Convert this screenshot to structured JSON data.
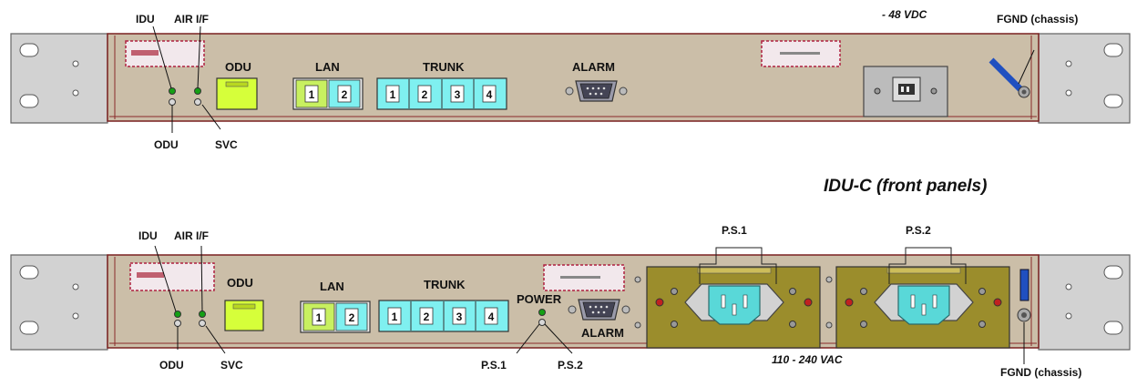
{
  "title": "IDU-C (front panels)",
  "dc_panel": {
    "idu_label": "IDU",
    "air_label": "AIR I/F",
    "odu_port_label": "ODU",
    "lan_label": "LAN",
    "lan_ports": [
      "1",
      "2"
    ],
    "trunk_label": "TRUNK",
    "trunk_ports": [
      "1",
      "2",
      "3",
      "4"
    ],
    "alarm_label": "ALARM",
    "odu_led_label": "ODU",
    "svc_led_label": "SVC",
    "dc_label": "- 48 VDC",
    "fgnd_label": "FGND (chassis)"
  },
  "ac_panel": {
    "idu_label": "IDU",
    "air_label": "AIR I/F",
    "odu_port_label": "ODU",
    "lan_label": "LAN",
    "lan_ports": [
      "1",
      "2"
    ],
    "trunk_label": "TRUNK",
    "trunk_ports": [
      "1",
      "2",
      "3",
      "4"
    ],
    "power_label": "POWER",
    "alarm_label": "ALARM",
    "odu_led_label": "ODU",
    "svc_led_label": "SVC",
    "ps1_led_label": "P.S.1",
    "ps2_led_label": "P.S.2",
    "ps1_label": "P.S.1",
    "ps2_label": "P.S.2",
    "ac_label": "110 - 240 VAC",
    "fgnd_label": "FGND (chassis)"
  },
  "colors": {
    "panel": "#cdbfa8",
    "panel_edge": "#8a2a2a",
    "ear": "#cfcfcf",
    "rj45_odu": "#d6ff3a",
    "lan1": "#c8f060",
    "trunk": "#7ff0f0",
    "psu_plate": "#9b8d2c",
    "iec_inlet": "#59d8d8",
    "led_green": "#14a014"
  }
}
